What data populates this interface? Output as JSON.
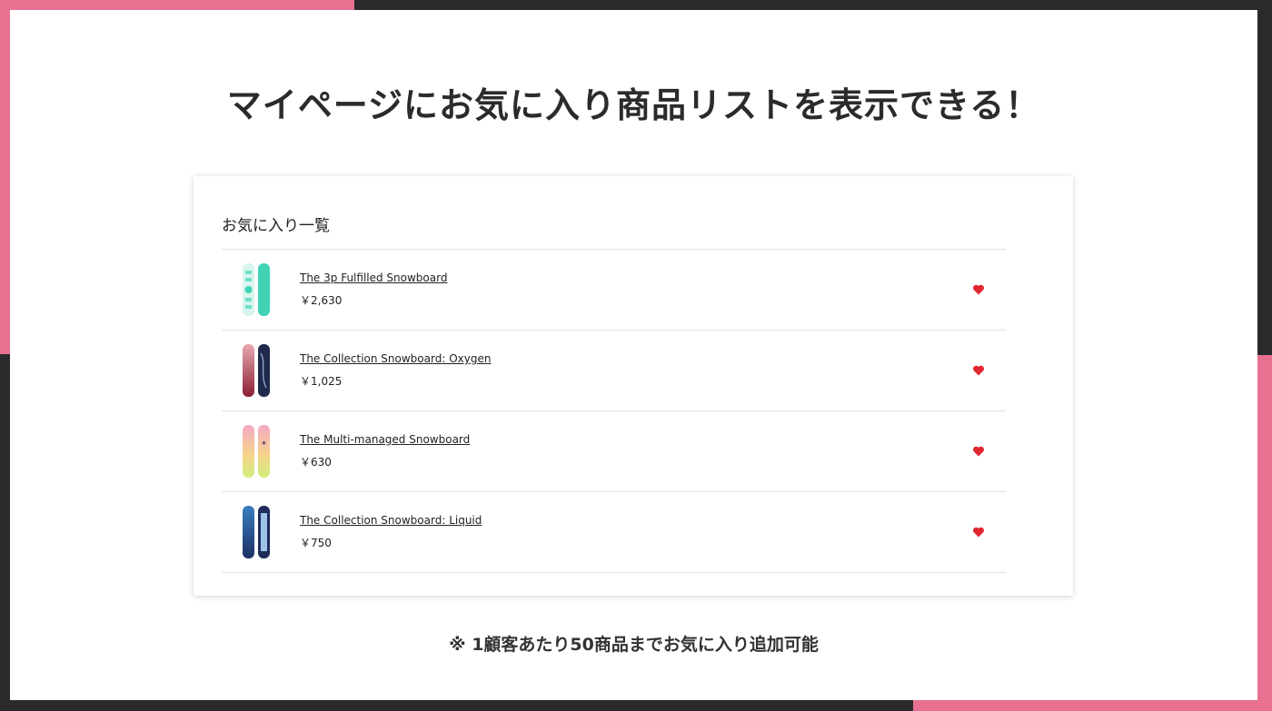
{
  "colors": {
    "accent": "#e87091",
    "frame": "#2a2a2c",
    "heart": "#e0262e"
  },
  "headline": "マイページにお気に入り商品リストを表示できる！",
  "card": {
    "title": "お気に入り一覧",
    "items": [
      {
        "name": "The 3p Fulfilled Snowboard",
        "price": "￥2,630",
        "thumb_icon": "snowboard-teal-thumbnail-icon"
      },
      {
        "name": "The Collection Snowboard: Oxygen",
        "price": "￥1,025",
        "thumb_icon": "snowboard-oxygen-thumbnail-icon"
      },
      {
        "name": "The Multi-managed Snowboard",
        "price": "￥630",
        "thumb_icon": "snowboard-pastel-thumbnail-icon"
      },
      {
        "name": "The Collection Snowboard: Liquid",
        "price": "￥750",
        "thumb_icon": "snowboard-liquid-thumbnail-icon"
      }
    ]
  },
  "note": "※ 1顧客あたり50商品までお気に入り追加可能"
}
